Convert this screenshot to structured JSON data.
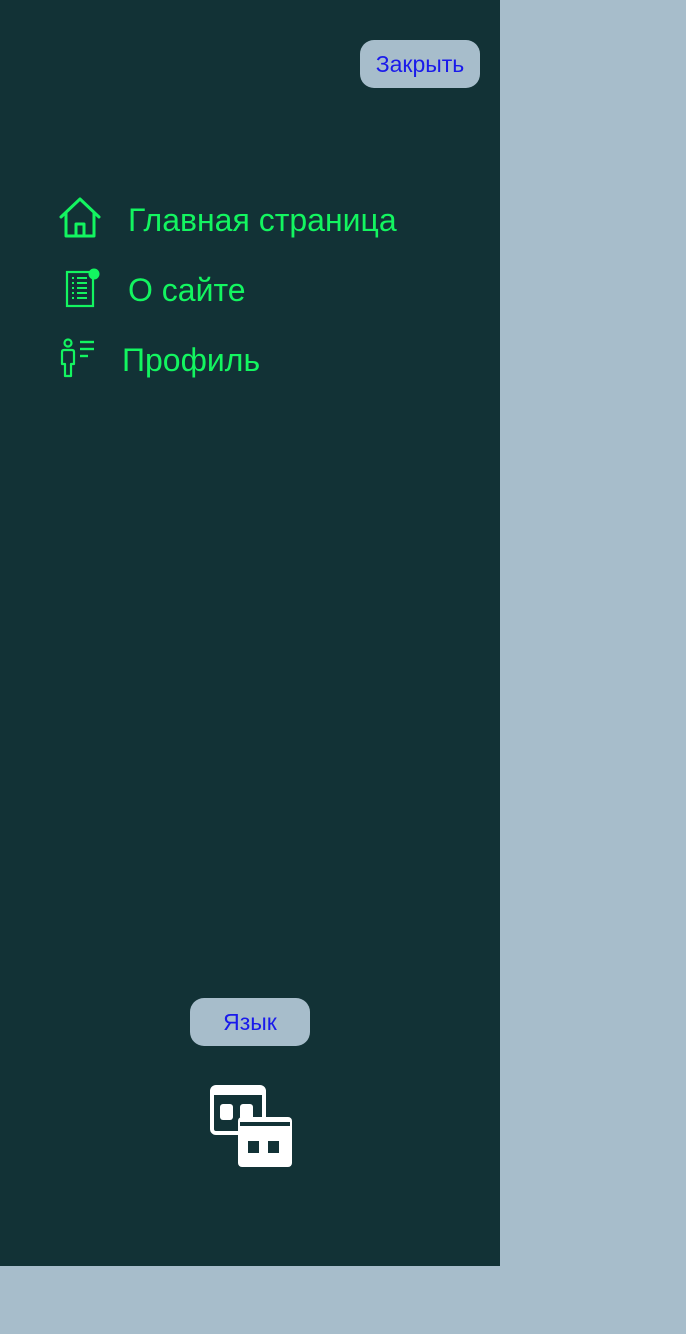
{
  "drawer": {
    "close_label": "Закрыть",
    "nav": [
      {
        "label": "Главная страница",
        "icon": "home-icon"
      },
      {
        "label": "О сайте",
        "icon": "document-icon"
      },
      {
        "label": "Профиль",
        "icon": "person-list-icon"
      }
    ],
    "language_label": "Язык",
    "language_icon": "language-switch-icon"
  },
  "colors": {
    "drawer_bg": "#123236",
    "page_bg": "#a7bdcb",
    "accent_green": "#13f560",
    "button_text": "#1a1aeb"
  }
}
